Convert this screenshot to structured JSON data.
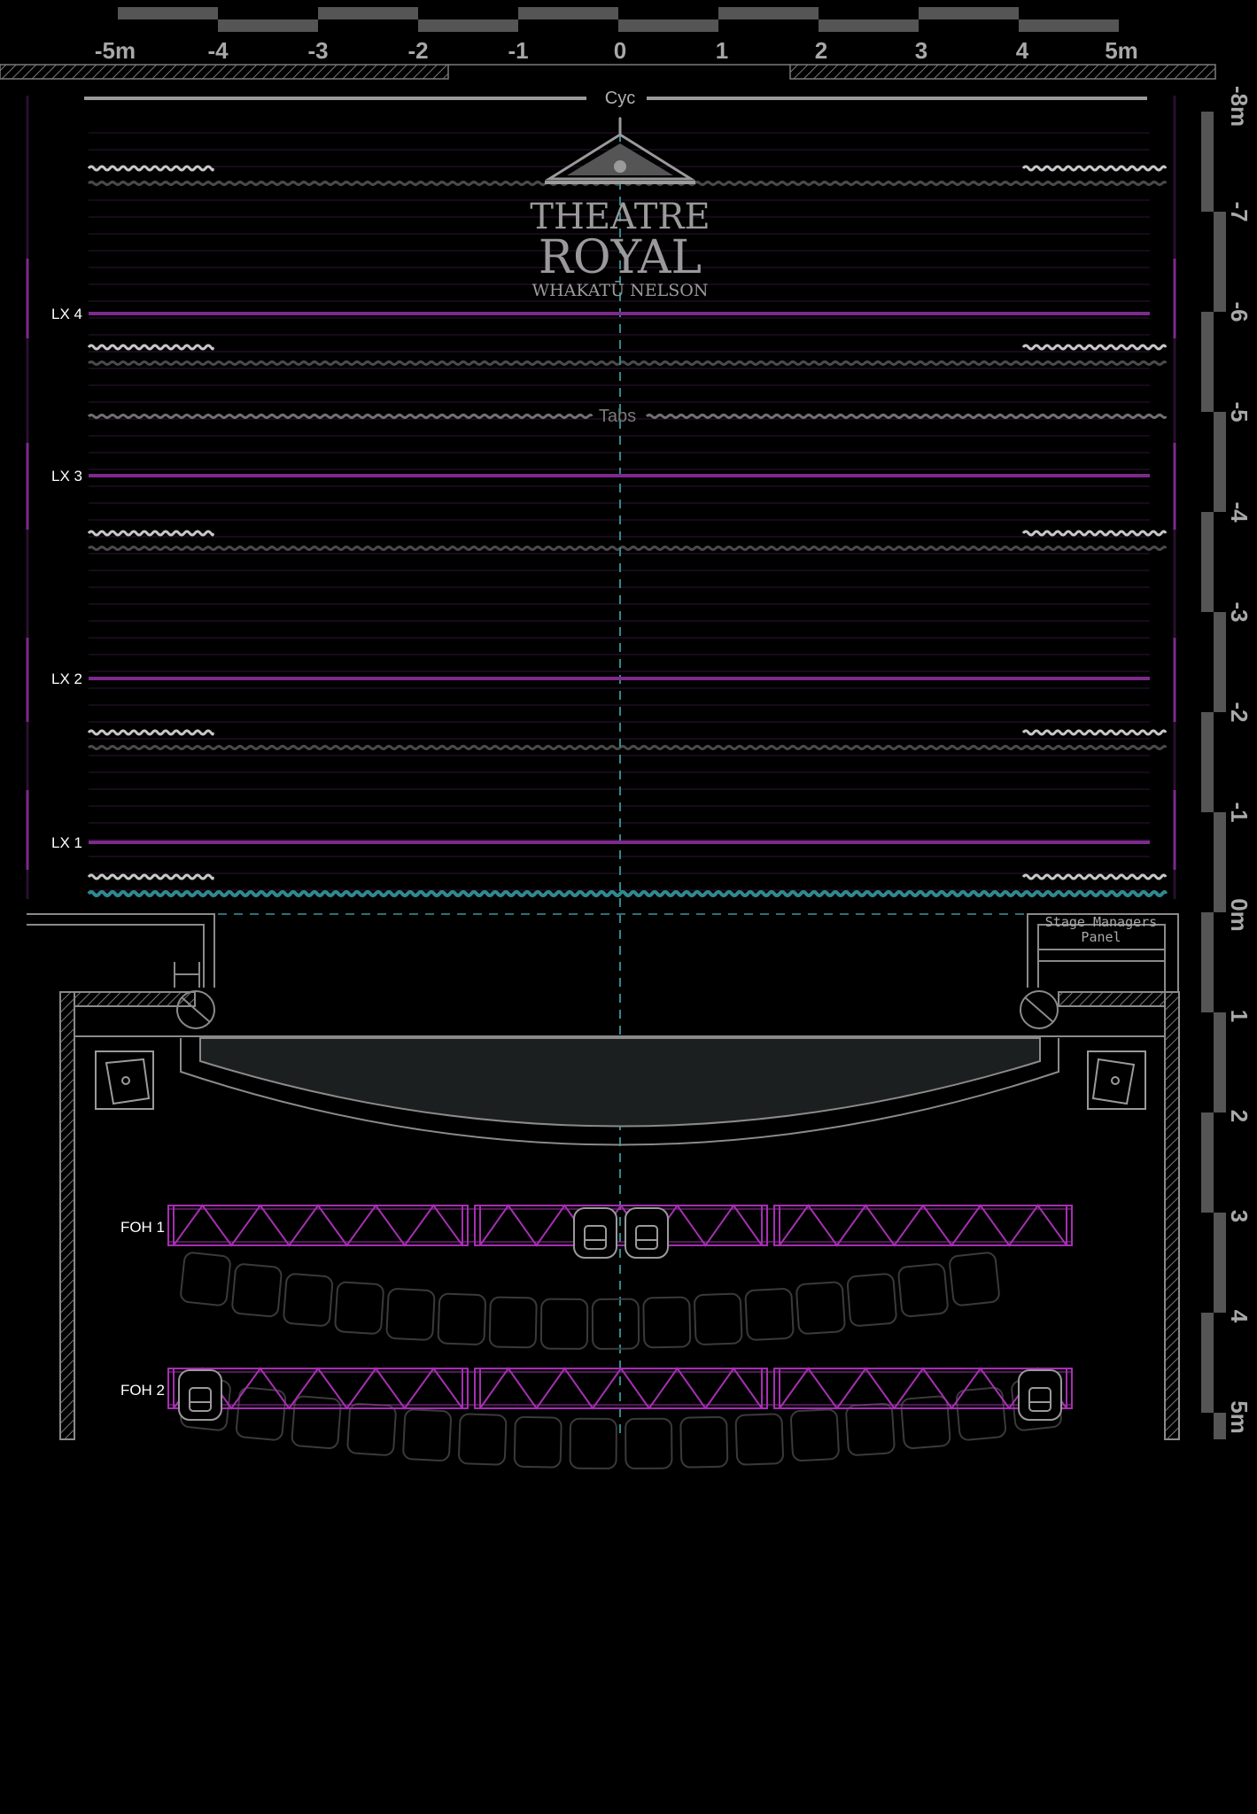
{
  "scale_top": {
    "labels": [
      "-5m",
      "-4",
      "-3",
      "-2",
      "-1",
      "0",
      "1",
      "2",
      "3",
      "4",
      "5m"
    ]
  },
  "scale_side": {
    "labels": [
      "-8m",
      "-7",
      "-6",
      "-5",
      "-4",
      "-3",
      "-2",
      "-1",
      "0m",
      "1",
      "2",
      "3",
      "4",
      "5m"
    ]
  },
  "curtains": {
    "cyc_label": "Cyc",
    "tabs_label": "Tabs"
  },
  "logo": {
    "line1": "THEATRE",
    "line2": "ROYAL",
    "line3": "WHAKATŪ NELSON"
  },
  "bars": [
    {
      "label": "LX 4"
    },
    {
      "label": "LX 3"
    },
    {
      "label": "LX 2"
    },
    {
      "label": "LX 1"
    }
  ],
  "foh": [
    {
      "label": "FOH 1"
    },
    {
      "label": "FOH 2"
    }
  ],
  "stage_managers_panel": {
    "line1": "Stage Managers",
    "line2": "Panel"
  },
  "colors": {
    "background": "#000000",
    "lx_bar": "#7d2a8c",
    "truss": "#a52fb0",
    "center_line": "#2f8a90",
    "scale": "#555555",
    "outline": "#8a8a8a"
  }
}
